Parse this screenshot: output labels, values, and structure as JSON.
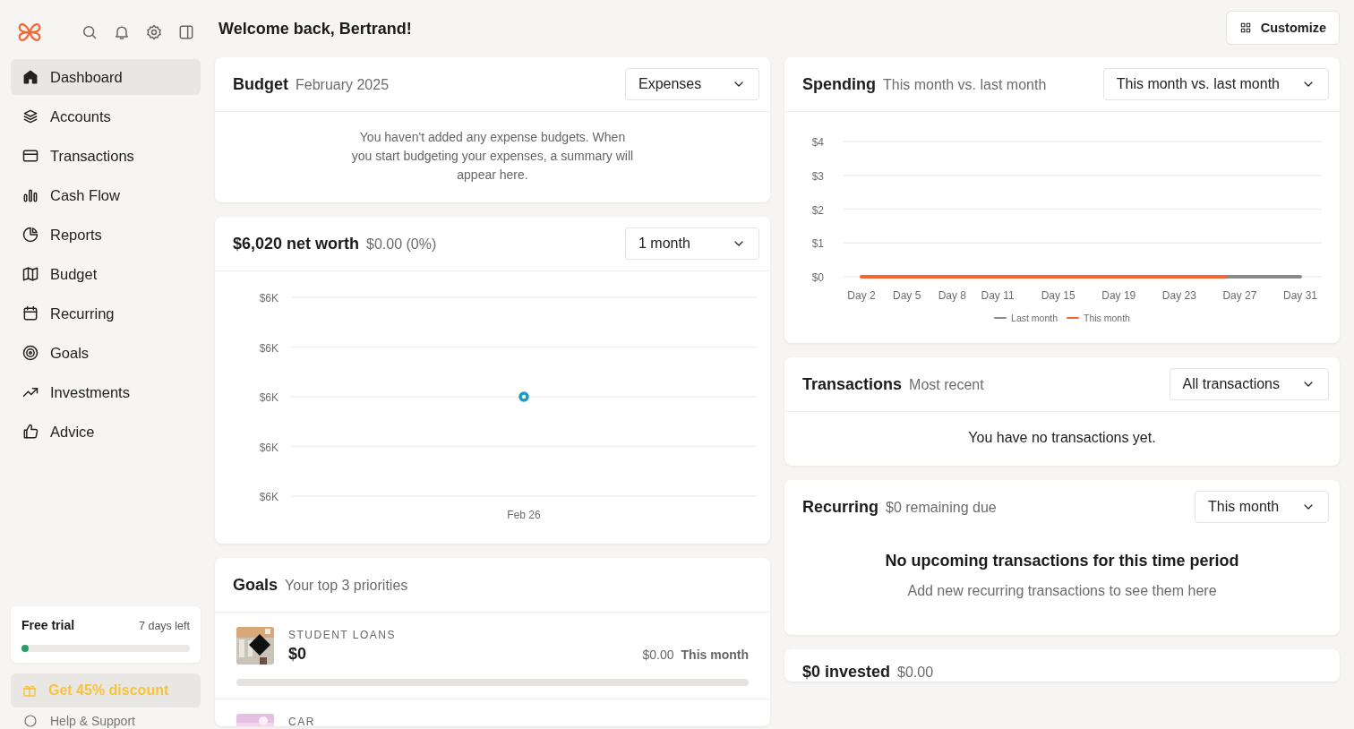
{
  "sidebar": {
    "nav": [
      {
        "label": "Dashboard",
        "selected": true
      },
      {
        "label": "Accounts",
        "selected": false
      },
      {
        "label": "Transactions",
        "selected": false
      },
      {
        "label": "Cash Flow",
        "selected": false
      },
      {
        "label": "Reports",
        "selected": false
      },
      {
        "label": "Budget",
        "selected": false
      },
      {
        "label": "Recurring",
        "selected": false
      },
      {
        "label": "Goals",
        "selected": false
      },
      {
        "label": "Investments",
        "selected": false
      },
      {
        "label": "Advice",
        "selected": false
      }
    ],
    "trial": {
      "title": "Free trial",
      "days_left": "7 days left",
      "level": 0.02
    },
    "discount_button": "Get 45% discount",
    "help_link": "Help & Support"
  },
  "header": {
    "greeting": "Welcome back, Bertrand!",
    "customize_button": "Customize"
  },
  "budget": {
    "title": "Budget",
    "subtitle": "February 2025",
    "dropdown": "Expenses",
    "message": "You haven't added any expense budgets. When you start budgeting your expenses, a summary will appear here."
  },
  "net_worth": {
    "title": "$6,020 net worth",
    "subtitle": "$0.00 (0%)",
    "dropdown": "1 month",
    "chart_data": {
      "type": "line",
      "categories": [
        "Feb 26"
      ],
      "grid": true,
      "series": [
        {
          "color": "#1a9bbf",
          "marker": true,
          "values": [
            6020
          ]
        }
      ],
      "ylim": [
        6000,
        6040
      ],
      "yticks": [
        {
          "value": 6040,
          "label": "$6K"
        },
        {
          "value": 6030,
          "label": "$6K"
        },
        {
          "value": 6020,
          "label": "$6K"
        },
        {
          "value": 6010,
          "label": "$6K"
        },
        {
          "value": 6000,
          "label": "$6K"
        }
      ]
    }
  },
  "goals": {
    "title": "Goals",
    "subtitle": "Your top 3 priorities",
    "items": [
      {
        "name": "STUDENT LOANS",
        "amount": "$0",
        "monthly": "$0.00",
        "period": "This month",
        "level": 0
      },
      {
        "name": "CAR"
      }
    ]
  },
  "spending": {
    "title": "Spending",
    "subtitle": "This month vs. last month",
    "dropdown": "This month vs. last month",
    "chart_data": {
      "type": "line",
      "grid": true,
      "categories": [
        "Day 2",
        null,
        null,
        "Day 5",
        null,
        null,
        "Day 8",
        null,
        null,
        "Day 11",
        null,
        null,
        null,
        "Day 15",
        null,
        null,
        null,
        "Day 19",
        null,
        null,
        null,
        "Day 23",
        null,
        null,
        null,
        "Day 27",
        null,
        null,
        null,
        "Day 31"
      ],
      "series": [
        {
          "name": "Last month",
          "color": "#8a8a8a",
          "values": [
            null,
            null,
            null,
            null,
            null,
            null,
            null,
            null,
            null,
            null,
            null,
            null,
            null,
            null,
            null,
            null,
            null,
            null,
            null,
            null,
            null,
            null,
            null,
            null,
            0,
            0,
            0,
            0,
            0,
            0
          ]
        },
        {
          "name": "This month",
          "color": "#fa6430",
          "values": [
            0,
            0,
            0,
            0,
            0,
            0,
            0,
            0,
            0,
            0,
            0,
            0,
            0,
            0,
            0,
            0,
            0,
            0,
            0,
            0,
            0,
            0,
            0,
            0,
            0,
            null,
            null,
            null,
            null,
            null
          ]
        }
      ],
      "ylim": [
        0,
        4
      ],
      "yticks": [
        {
          "value": 4,
          "label": "$4"
        },
        {
          "value": 3,
          "label": "$3"
        },
        {
          "value": 2,
          "label": "$2"
        },
        {
          "value": 1,
          "label": "$1"
        },
        {
          "value": 0,
          "label": "$0"
        }
      ]
    }
  },
  "transactions": {
    "title": "Transactions",
    "subtitle": "Most recent",
    "dropdown": "All transactions",
    "message": "You have no transactions yet."
  },
  "recurring": {
    "title": "Recurring",
    "subtitle": "$0 remaining due",
    "dropdown": "This month",
    "empty_title": "No upcoming transactions for this time period",
    "empty_text": "Add new recurring transactions to see them here"
  },
  "investments": {
    "title": "$0 invested",
    "subtitle": "$0.00"
  }
}
